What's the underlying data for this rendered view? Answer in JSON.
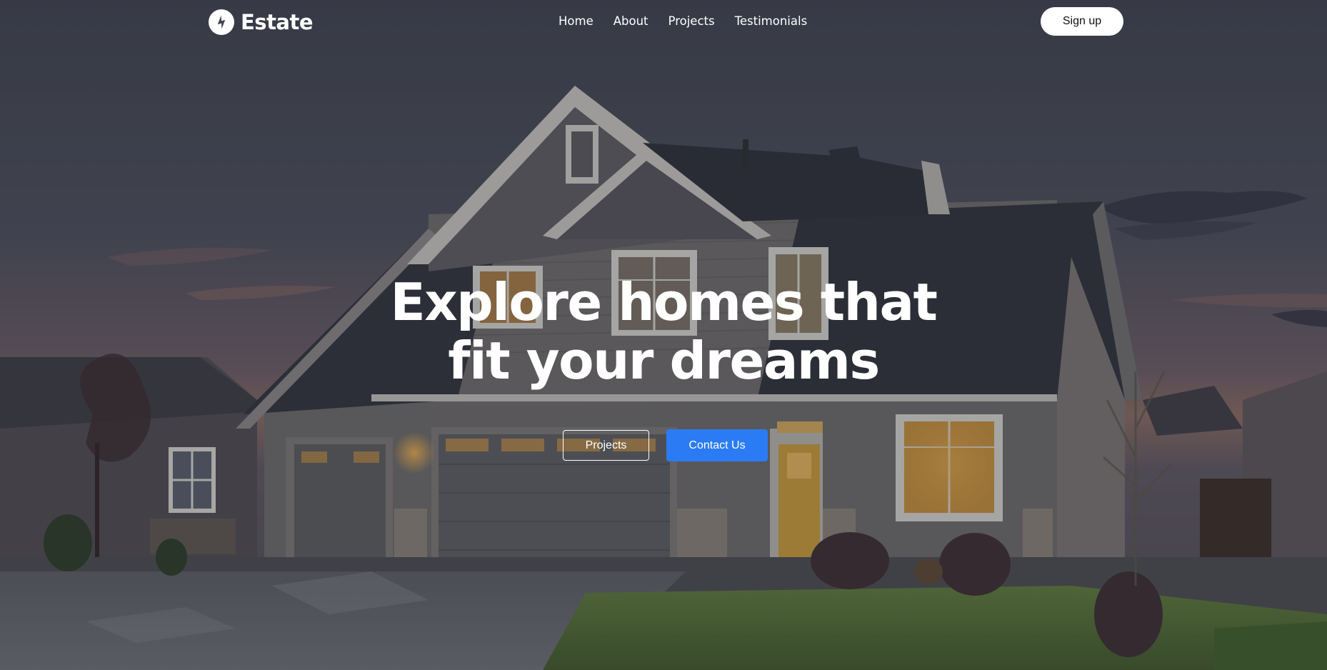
{
  "brand": {
    "name": "Estate",
    "icon": "lightning-bolt-icon"
  },
  "nav": {
    "links": [
      "Home",
      "About",
      "Projects",
      "Testimonials"
    ],
    "signup_label": "Sign up"
  },
  "hero": {
    "headline_line1": "Explore homes that",
    "headline_line2": "fit your dreams",
    "background": "twilight-house-photo",
    "buttons": {
      "projects_label": "Projects",
      "contact_label": "Contact Us"
    }
  },
  "colors": {
    "primary_button": "#2b7cf4",
    "text": "#ffffff"
  }
}
